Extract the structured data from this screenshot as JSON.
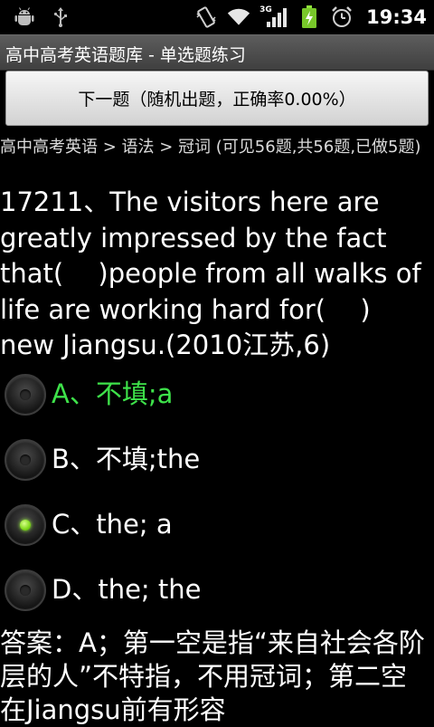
{
  "status_bar": {
    "left_icons": [
      "android-debug-icon",
      "usb-icon"
    ],
    "right_icons": [
      "vibrate-icon",
      "wifi-icon",
      "3g-signal-icon",
      "battery-charging-icon",
      "alarm-icon"
    ],
    "network_label": "3G",
    "time": "19:34"
  },
  "title_bar": {
    "title": "高中高考英语题库 - 单选题练习"
  },
  "next_button": {
    "label": "下一题（随机出题，正确率0.00%）"
  },
  "breadcrumb": "高中高考英语 > 语法 > 冠词 (可见56题,共56题,已做5题)",
  "question": {
    "text": "17211、The visitors here are greatly impressed by the fact that(　 )people from all walks of life are working hard for(　 ) new Jiangsu.(2010江苏,6)"
  },
  "options": [
    {
      "label": "A、不填;a",
      "checked": false,
      "color": "#3ee24a"
    },
    {
      "label": "B、不填;the",
      "checked": false,
      "color": "#ffffff"
    },
    {
      "label": "C、the; a",
      "checked": true,
      "color": "#ffffff"
    },
    {
      "label": "D、the; the",
      "checked": false,
      "color": "#ffffff"
    }
  ],
  "answer": {
    "text": "答案：A；第一空是指“来自社会各阶层的人”不特指，不用冠词；第二空在Jiangsu前有形容"
  },
  "colors": {
    "correct_option": "#3ee24a",
    "radio_checked": "#7fd81a"
  }
}
